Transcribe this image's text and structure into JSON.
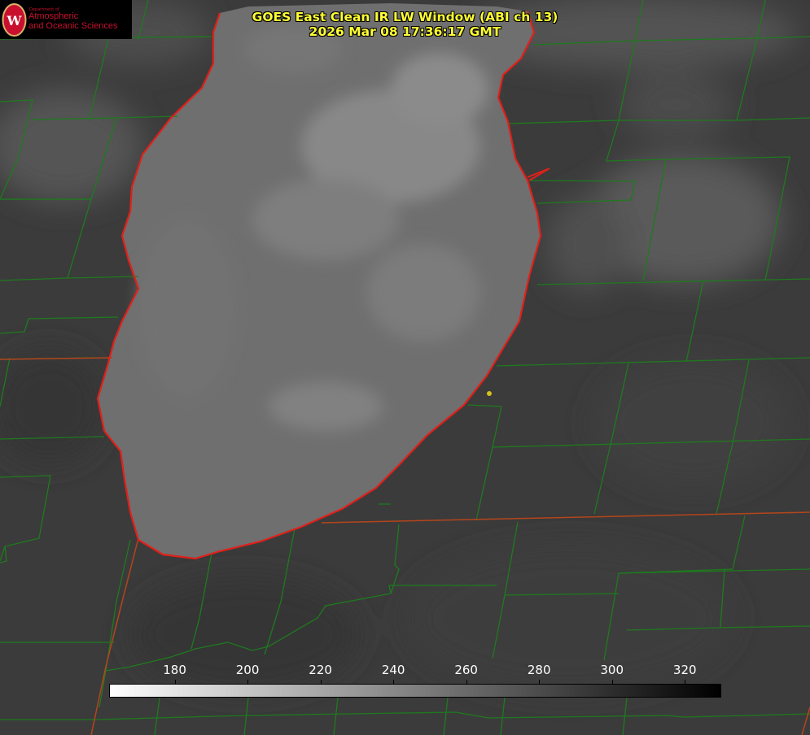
{
  "header": {
    "title_line1": "GOES East Clean IR LW Window (ABI ch 13)",
    "title_line2": "2026 Mar 08 17:36:17 GMT"
  },
  "logo": {
    "dept": "Department of",
    "line1": "Atmospheric",
    "line2": "and Oceanic Sciences",
    "seal_letter": "W"
  },
  "colorbar": {
    "ticks": [
      "180",
      "200",
      "220",
      "240",
      "260",
      "280",
      "300",
      "320"
    ],
    "range": [
      162,
      330
    ],
    "gradient_from": "#ffffff",
    "gradient_to": "#000000"
  },
  "colors": {
    "county_lines": "#1e7a1e",
    "state_lines": "#b5451b",
    "lake_outline": "#e0201a",
    "station_marker": "#d4c21a",
    "title_text": "#ffff33"
  }
}
